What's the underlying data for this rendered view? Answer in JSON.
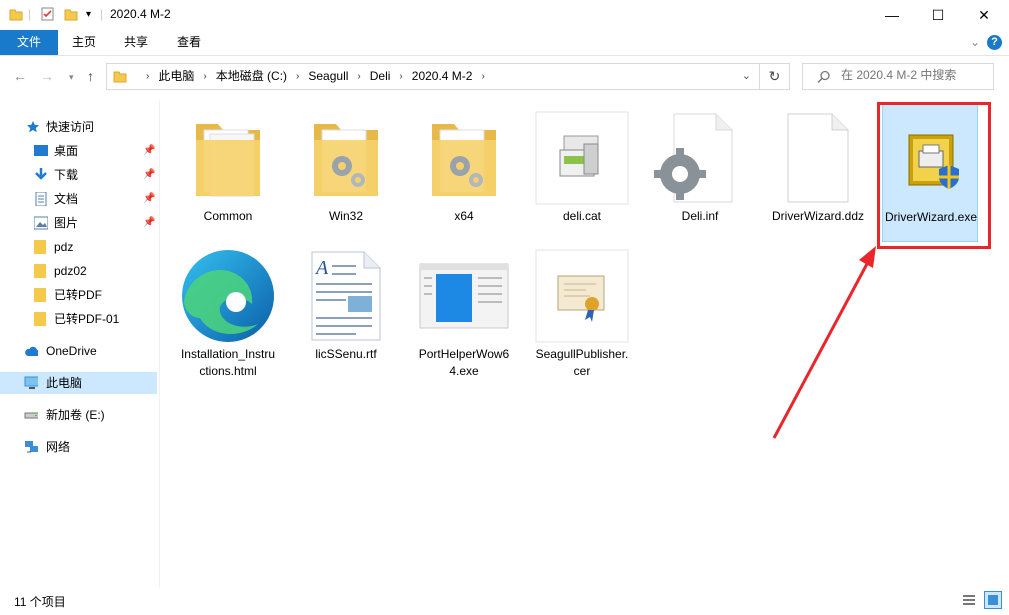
{
  "window": {
    "title": "2020.4 M-2",
    "minimize": "—",
    "maximize": "☐",
    "close": "✕"
  },
  "ribbon": {
    "tabs": [
      "文件",
      "主页",
      "共享",
      "查看"
    ],
    "collapse": "⌄",
    "help": "?"
  },
  "address": {
    "crumbs": [
      "此电脑",
      "本地磁盘 (C:)",
      "Seagull",
      "Deli",
      "2020.4 M-2"
    ],
    "search_placeholder": "在 2020.4 M-2 中搜索"
  },
  "sidebar": {
    "items": [
      {
        "label": "快速访问",
        "icon": "star-icon"
      },
      {
        "label": "桌面",
        "icon": "desktop-icon",
        "pinned": true
      },
      {
        "label": "下载",
        "icon": "download-icon",
        "pinned": true
      },
      {
        "label": "文档",
        "icon": "document-icon",
        "pinned": true
      },
      {
        "label": "图片",
        "icon": "picture-icon",
        "pinned": true
      },
      {
        "label": "pdz",
        "icon": "folder-icon"
      },
      {
        "label": "pdz02",
        "icon": "folder-icon"
      },
      {
        "label": "已转PDF",
        "icon": "folder-icon"
      },
      {
        "label": "已转PDF-01",
        "icon": "folder-icon"
      },
      {
        "label": "OneDrive",
        "icon": "cloud-icon"
      },
      {
        "label": "此电脑",
        "icon": "computer-icon",
        "selected": true
      },
      {
        "label": "新加卷 (E:)",
        "icon": "drive-icon"
      },
      {
        "label": "网络",
        "icon": "network-icon"
      }
    ]
  },
  "files": [
    {
      "name": "Common",
      "icon": "folder-icon"
    },
    {
      "name": "Win32",
      "icon": "folder-gear-icon"
    },
    {
      "name": "x64",
      "icon": "folder-gear-icon"
    },
    {
      "name": "deli.cat",
      "icon": "catalog-icon"
    },
    {
      "name": "Deli.inf",
      "icon": "gear-file-icon"
    },
    {
      "name": "DriverWizard.ddz",
      "icon": "blank-file-icon"
    },
    {
      "name": "DriverWizard.exe",
      "icon": "printer-shield-icon"
    },
    {
      "name": "Installation_Instructions.html",
      "icon": "edge-icon"
    },
    {
      "name": "licSSenu.rtf",
      "icon": "rtf-icon"
    },
    {
      "name": "PortHelperWow64.exe",
      "icon": "app-window-icon"
    },
    {
      "name": "SeagullPublisher.cer",
      "icon": "certificate-icon"
    }
  ],
  "status": {
    "count": "11 个项目"
  },
  "colors": {
    "accent": "#1979ca",
    "highlight": "#e8262b",
    "selection": "#cce8ff"
  }
}
